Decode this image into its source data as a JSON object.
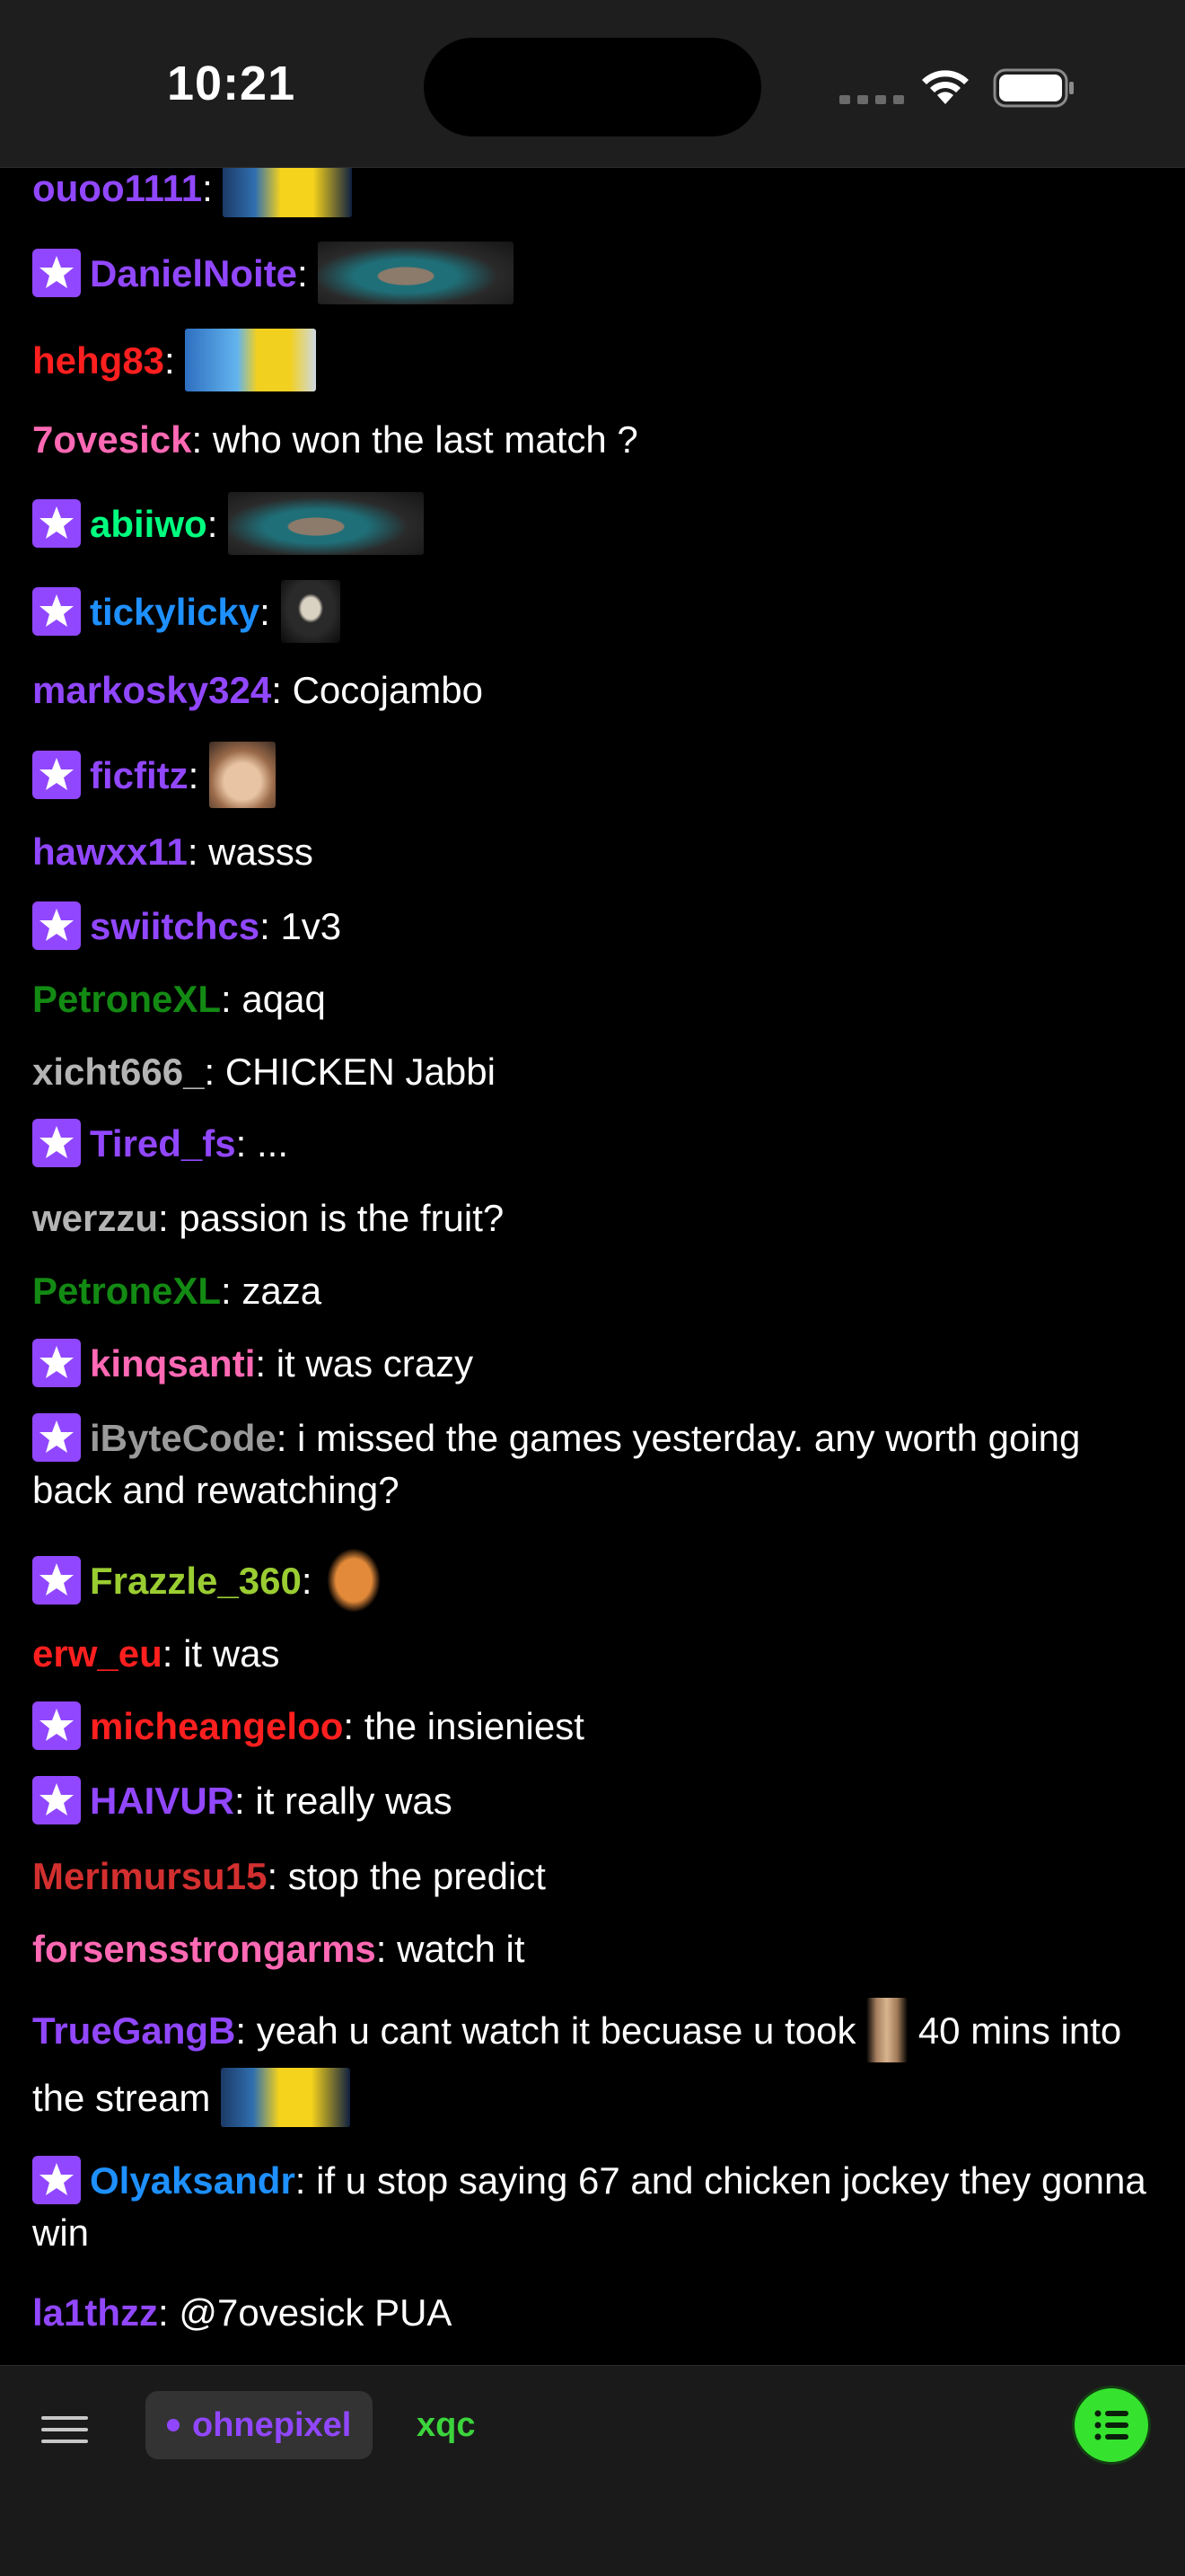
{
  "status_bar": {
    "time": "10:21"
  },
  "messages": [
    {
      "user": "ouoo1111",
      "color": "#9147ff",
      "badge": false,
      "text": "",
      "emotes_after": [
        "minion"
      ]
    },
    {
      "user": "DanielNoite",
      "color": "#9147ff",
      "badge": true,
      "text": "",
      "emotes_after": [
        "man"
      ]
    },
    {
      "user": "hehg83",
      "color": "#ff1f1f",
      "badge": false,
      "text": "",
      "emotes_after": [
        "fish"
      ]
    },
    {
      "user": "7ovesick",
      "color": "#ff69b4",
      "badge": false,
      "text": "who won the last match ?"
    },
    {
      "user": "abiiwo",
      "color": "#00ff7f",
      "badge": true,
      "text": "",
      "emotes_after": [
        "man"
      ]
    },
    {
      "user": "tickylicky",
      "color": "#1e90ff",
      "badge": true,
      "text": "",
      "emotes_after": [
        "hood"
      ]
    },
    {
      "user": "markosky324",
      "color": "#9147ff",
      "badge": false,
      "text": "Cocojambo"
    },
    {
      "user": "ficfitz",
      "color": "#9147ff",
      "badge": true,
      "text": "",
      "emotes_after": [
        "face"
      ]
    },
    {
      "user": "hawxx11",
      "color": "#9147ff",
      "badge": false,
      "text": "wasss"
    },
    {
      "user": "swiitchcs",
      "color": "#9147ff",
      "badge": true,
      "text": "1v3"
    },
    {
      "user": "PetroneXL",
      "color": "#138a13",
      "badge": false,
      "text": "aqaq"
    },
    {
      "user": "xicht666_",
      "color": "#b4b4b4",
      "badge": false,
      "text": "CHICKEN Jabbi"
    },
    {
      "user": "Tired_fs",
      "color": "#9147ff",
      "badge": true,
      "text": "..."
    },
    {
      "user": "werzzu",
      "color": "#b4b4b4",
      "badge": false,
      "text": "passion is the fruit?"
    },
    {
      "user": "PetroneXL",
      "color": "#138a13",
      "badge": false,
      "text": "zaza"
    },
    {
      "user": "kinqsanti",
      "color": "#ff69b4",
      "badge": true,
      "text": "it was crazy"
    },
    {
      "user": "iByteCode",
      "color": "#9a9a9a",
      "badge": true,
      "text": "i missed the games yesterday. any worth going back and rewatching?"
    },
    {
      "user": "Frazzle_360",
      "color": "#9acd32",
      "badge": true,
      "text": "",
      "emotes_after": [
        "orange"
      ]
    },
    {
      "user": "erw_eu",
      "color": "#ff1f1f",
      "badge": false,
      "text": "it was"
    },
    {
      "user": "micheangeloo",
      "color": "#ff1f1f",
      "badge": true,
      "text": "the insieniest"
    },
    {
      "user": "HAIVUR",
      "color": "#9147ff",
      "badge": true,
      "text": "it really was"
    },
    {
      "user": "Merimursu15",
      "color": "#d32f2f",
      "badge": false,
      "text": "stop the predict"
    },
    {
      "user": "forsensstrongarms",
      "color": "#ff69b4",
      "badge": false,
      "text": "watch it"
    },
    {
      "user": "TrueGangB",
      "color": "#9147ff",
      "badge": false,
      "text_parts": [
        "yeah u cant watch it becuase u took",
        "40 mins into the stream"
      ],
      "emotes_inline": [
        "stick"
      ],
      "emotes_after": [
        "minion"
      ]
    },
    {
      "user": "Olyaksandr",
      "color": "#1e90ff",
      "badge": true,
      "text": "if u stop saying 67 and chicken jockey they gonna win"
    },
    {
      "user": "la1thzz",
      "color": "#9147ff",
      "badge": false,
      "text": "@7ovesick PUA"
    }
  ],
  "bottom_bar": {
    "tabs": [
      {
        "label": "ohnepixel",
        "active": true,
        "color": "#9147ff"
      },
      {
        "label": "xqc",
        "active": false,
        "color": "#3cd43c"
      }
    ],
    "menu_icon": "hamburger-menu-icon",
    "chat_list_icon": "list-icon"
  }
}
